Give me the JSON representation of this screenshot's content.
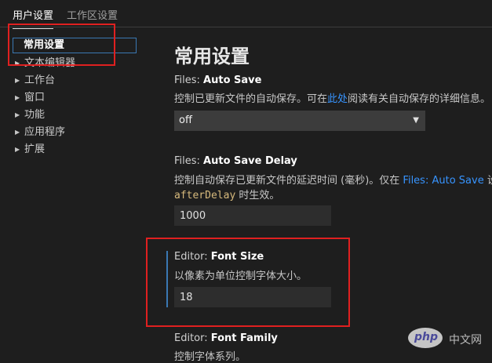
{
  "tabs": [
    {
      "label": "用户设置",
      "active": true
    },
    {
      "label": "工作区设置",
      "active": false
    }
  ],
  "tree": {
    "selected": "常用设置",
    "items": [
      {
        "label": "文本编辑器"
      },
      {
        "label": "工作台"
      },
      {
        "label": "窗口"
      },
      {
        "label": "功能"
      },
      {
        "label": "应用程序"
      },
      {
        "label": "扩展"
      }
    ]
  },
  "main": {
    "title": "常用设置",
    "settings": [
      {
        "category": "Files: ",
        "name": "Auto Save",
        "desc_before": "控制已更新文件的自动保存。可在",
        "desc_link": "此处",
        "desc_after": "阅读有关自动保存的详细信息。",
        "value": "off"
      },
      {
        "category": "Files: ",
        "name": "Auto Save Delay",
        "desc_line1_before": "控制自动保存已更新文件的延迟时间 (毫秒)。仅在 ",
        "desc_line1_link": "Files: Auto Save",
        "desc_line1_after": " 设置",
        "desc_line2_code": "afterDelay",
        "desc_line2_after": " 时生效。",
        "value": "1000"
      },
      {
        "category": "Editor: ",
        "name": "Font Size",
        "desc": "以像素为单位控制字体大小。",
        "value": "18"
      },
      {
        "category": "Editor: ",
        "name": "Font Family",
        "desc": "控制字体系列。"
      }
    ]
  },
  "watermark": {
    "logo": "php",
    "text": "中文网"
  },
  "colors": {
    "accent": "#3a78b3",
    "link": "#3794ff",
    "highlight_box": "#e02020"
  }
}
